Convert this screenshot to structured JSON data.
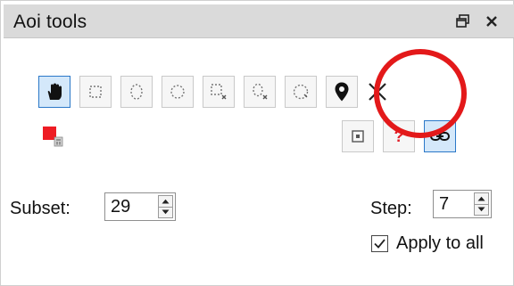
{
  "window": {
    "title": "Aoi tools"
  },
  "toolbar": {
    "tools": [
      {
        "icon": "hand-pan-icon",
        "state": "active"
      },
      {
        "icon": "rectangle-select-icon",
        "state": "normal"
      },
      {
        "icon": "ellipse-select-icon",
        "state": "normal"
      },
      {
        "icon": "circle-select-icon",
        "state": "normal"
      },
      {
        "icon": "rectangle-subtract-icon",
        "state": "normal"
      },
      {
        "icon": "ellipse-subtract-icon",
        "state": "normal"
      },
      {
        "icon": "polygon-select-icon",
        "state": "normal"
      },
      {
        "icon": "map-pin-icon",
        "state": "normal"
      },
      {
        "icon": "x-icon",
        "state": "normal"
      }
    ],
    "row2": [
      {
        "icon": "red-square-delete-icon"
      },
      {
        "icon": "center-point-icon"
      },
      {
        "icon": "question-icon",
        "color": "#e0202a"
      },
      {
        "icon": "link-icon",
        "state": "active"
      }
    ]
  },
  "subset": {
    "label": "Subset:",
    "value": "29"
  },
  "step": {
    "label": "Step:",
    "value": "7"
  },
  "apply_all": {
    "label": "Apply to all",
    "checked": true
  },
  "colors": {
    "accent": "#2b78c8",
    "accent_bg": "#d4e8fa",
    "annotation": "#e3191a",
    "titlebar": "#dadada"
  }
}
